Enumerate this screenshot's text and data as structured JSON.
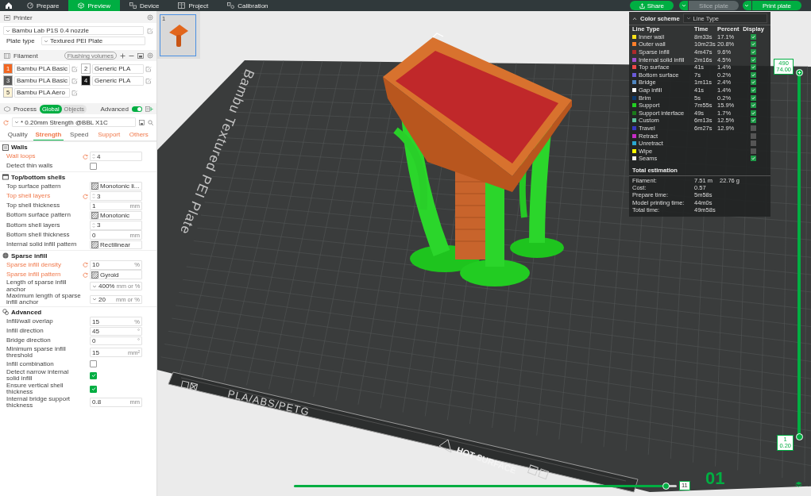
{
  "top_bar": {
    "tabs": [
      {
        "label": "Prepare",
        "selected": false
      },
      {
        "label": "Preview",
        "selected": true
      },
      {
        "label": "Device",
        "selected": false
      },
      {
        "label": "Project",
        "selected": false
      },
      {
        "label": "Calibration",
        "selected": false
      }
    ],
    "actions": [
      {
        "kind": "share",
        "label": "Share",
        "disabled": false
      },
      {
        "kind": "split",
        "label": "Slice plate",
        "disabled": true
      },
      {
        "kind": "split",
        "label": "Print plate",
        "disabled": false
      }
    ]
  },
  "printer": {
    "title": "Printer",
    "preset": "Bambu Lab P1S 0.4 nozzle",
    "plate_type_label": "Plate type",
    "plate_type": "Textured PEI Plate"
  },
  "filament": {
    "title": "Filament",
    "flushing_button": "Flushing volumes",
    "items": [
      {
        "number": "1",
        "name": "Bambu PLA Basic",
        "color": "#f26722"
      },
      {
        "number": "2",
        "name": "Generic PLA",
        "color": "#ffffff"
      },
      {
        "number": "3",
        "name": "Bambu PLA Basic",
        "color": "#5a5a5a"
      },
      {
        "number": "4",
        "name": "Generic PLA",
        "color": "#161616"
      },
      {
        "number": "5",
        "name": "Bambu PLA Aero",
        "color": "#fff4d6"
      }
    ]
  },
  "process": {
    "title": "Process",
    "scope": [
      {
        "label": "Global",
        "selected": true
      },
      {
        "label": "Objects",
        "selected": false
      }
    ],
    "advanced_label": "Advanced",
    "advanced_on": true,
    "preset": "* 0.20mm Strength @BBL X1C",
    "tabs": [
      {
        "label": "Quality",
        "selected": false,
        "modified": false
      },
      {
        "label": "Strength",
        "selected": true,
        "modified": true
      },
      {
        "label": "Speed",
        "selected": false,
        "modified": false
      },
      {
        "label": "Support",
        "selected": false,
        "modified": true
      },
      {
        "label": "Others",
        "selected": false,
        "modified": true
      }
    ],
    "groups": [
      {
        "title": "Walls",
        "settings": [
          {
            "label": "Wall loops",
            "kind": "spin",
            "value": "4",
            "modified": true
          },
          {
            "label": "Detect thin walls",
            "kind": "checkbox",
            "checked": false,
            "modified": false
          }
        ]
      },
      {
        "title": "Top/bottom shells",
        "settings": [
          {
            "label": "Top surface pattern",
            "kind": "pattern",
            "value": "Monotonic li...",
            "modified": false
          },
          {
            "label": "Top shell layers",
            "kind": "spin",
            "value": "3",
            "modified": true
          },
          {
            "label": "Top shell thickness",
            "kind": "input",
            "value": "1",
            "unit": "mm",
            "modified": false
          },
          {
            "label": "Bottom surface pattern",
            "kind": "pattern",
            "value": "Monotonic",
            "modified": false
          },
          {
            "label": "Bottom shell layers",
            "kind": "spin",
            "value": "3",
            "modified": false
          },
          {
            "label": "Bottom shell thickness",
            "kind": "input",
            "value": "0",
            "unit": "mm",
            "modified": false
          },
          {
            "label": "Internal solid infill pattern",
            "kind": "pattern",
            "value": "Rectilinear",
            "modified": false
          }
        ]
      },
      {
        "title": "Sparse infill",
        "settings": [
          {
            "label": "Sparse infill density",
            "kind": "input",
            "value": "10",
            "unit": "%",
            "modified": true
          },
          {
            "label": "Sparse infill pattern",
            "kind": "pattern",
            "value": "Gyroid",
            "modified": true
          },
          {
            "label": "Length of sparse infill anchor",
            "kind": "combo",
            "value": "400%",
            "unit": "mm or %",
            "modified": false
          },
          {
            "label": "Maximum length of sparse infill anchor",
            "kind": "combo",
            "value": "20",
            "unit": "mm or %",
            "modified": false
          }
        ]
      },
      {
        "title": "Advanced",
        "settings": [
          {
            "label": "Infill/wall overlap",
            "kind": "input",
            "value": "15",
            "unit": "%",
            "modified": false
          },
          {
            "label": "Infill direction",
            "kind": "input",
            "value": "45",
            "unit": "°",
            "modified": false
          },
          {
            "label": "Bridge direction",
            "kind": "input",
            "value": "0",
            "unit": "°",
            "modified": false
          },
          {
            "label": "Minimum sparse infill threshold",
            "kind": "input",
            "value": "15",
            "unit": "mm²",
            "modified": false
          },
          {
            "label": "Infill combination",
            "kind": "checkbox",
            "checked": false,
            "modified": false
          },
          {
            "label": "Detect narrow internal solid infill",
            "kind": "checkbox",
            "checked": true,
            "modified": false
          },
          {
            "label": "Ensure vertical shell thickness",
            "kind": "checkbox",
            "checked": true,
            "modified": false
          },
          {
            "label": "Internal bridge support thickness",
            "kind": "input",
            "value": "0.8",
            "unit": "mm",
            "modified": false
          }
        ]
      }
    ]
  },
  "plate_thumbnails": [
    {
      "number": "1",
      "selected": true
    }
  ],
  "plate": {
    "name": "Bambu Textured PEI Plate",
    "filament_types": "PLA/ABS/PETG",
    "warning": "HOT SURFACE",
    "number": "01"
  },
  "legend": {
    "title": "Color scheme",
    "scheme": "Line Type",
    "columns": [
      "Line Type",
      "Time",
      "Percent",
      "Display"
    ],
    "rows": [
      {
        "name": "Inner wall",
        "color": "#ffe21a",
        "time": "8m33s",
        "percent": "17.1%",
        "displayed": true
      },
      {
        "name": "Outer wall",
        "color": "#ff7f2a",
        "time": "10m23s",
        "percent": "20.8%",
        "displayed": true
      },
      {
        "name": "Sparse infill",
        "color": "#b02a2a",
        "time": "4m47s",
        "percent": "9.6%",
        "displayed": true
      },
      {
        "name": "Internal solid infill",
        "color": "#a050d0",
        "time": "2m16s",
        "percent": "4.5%",
        "displayed": true
      },
      {
        "name": "Top surface",
        "color": "#f04848",
        "time": "41s",
        "percent": "1.4%",
        "displayed": true
      },
      {
        "name": "Bottom surface",
        "color": "#6a5ad8",
        "time": "7s",
        "percent": "0.2%",
        "displayed": true
      },
      {
        "name": "Bridge",
        "color": "#4f86c0",
        "time": "1m11s",
        "percent": "2.4%",
        "displayed": true
      },
      {
        "name": "Gap infill",
        "color": "#ffffff",
        "time": "41s",
        "percent": "1.4%",
        "displayed": true
      },
      {
        "name": "Brim",
        "color": "#0d3a6e",
        "time": "5s",
        "percent": "0.2%",
        "displayed": true
      },
      {
        "name": "Support",
        "color": "#22d022",
        "time": "7m55s",
        "percent": "15.9%",
        "displayed": true
      },
      {
        "name": "Support interface",
        "color": "#1a7a1a",
        "time": "49s",
        "percent": "1.7%",
        "displayed": true
      },
      {
        "name": "Custom",
        "color": "#5ec39c",
        "time": "6m13s",
        "percent": "12.5%",
        "displayed": true
      },
      {
        "name": "Travel",
        "color": "#3838c0",
        "time": "6m27s",
        "percent": "12.9%",
        "displayed": false
      },
      {
        "name": "Retract",
        "color": "#c82cc8",
        "displayed": false
      },
      {
        "name": "Unretract",
        "color": "#2aa8d0",
        "displayed": false
      },
      {
        "name": "Wipe",
        "color": "#ffff00",
        "displayed": false
      },
      {
        "name": "Seams",
        "color": "#f4f4f4",
        "displayed": true
      }
    ],
    "total": {
      "title": "Total estimation",
      "rows": [
        {
          "label": "Filament:",
          "values": [
            "7.51 m",
            "22.76 g"
          ]
        },
        {
          "label": "Cost:",
          "values": [
            "0.57"
          ]
        },
        {
          "label": "Prepare time:",
          "values": [
            "5m58s"
          ]
        },
        {
          "label": "Model printing time:",
          "values": [
            "44m0s"
          ]
        },
        {
          "label": "Total time:",
          "values": [
            "49m58s"
          ]
        }
      ]
    }
  },
  "layer_slider": {
    "top_labels": [
      "490",
      "74.00"
    ],
    "bottom_labels": [
      "1",
      "0.20"
    ],
    "level": 1
  },
  "move_slider": {
    "label": "11",
    "level": 0.97
  }
}
